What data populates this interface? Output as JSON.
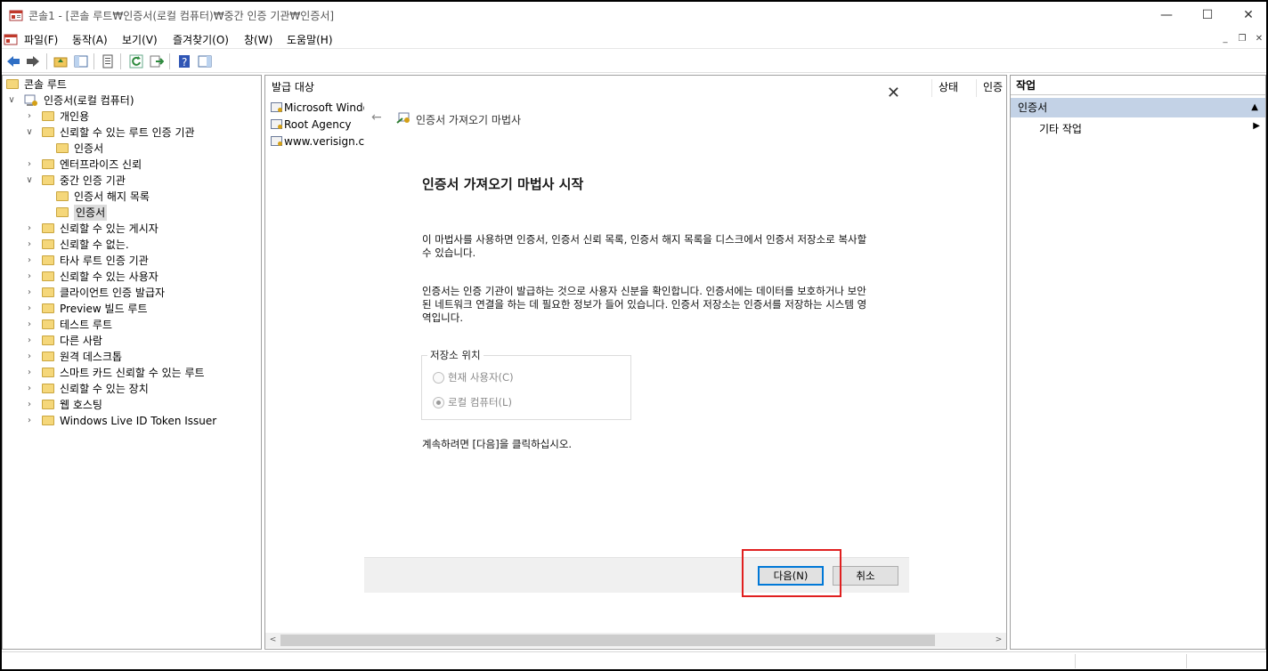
{
  "window": {
    "title": "콘솔1 - [콘솔 루트₩인증서(로컬 컴퓨터)₩중간 인증 기관₩인증서]",
    "minimize": "—",
    "maximize": "☐",
    "close": "✕"
  },
  "menu": [
    "파일(F)",
    "동작(A)",
    "보기(V)",
    "즐겨찾기(O)",
    "창(W)",
    "도움말(H)"
  ],
  "toolbar_icons": [
    "back-icon",
    "forward-icon",
    "up-folder-icon",
    "show-hide-tree-icon",
    "properties-icon",
    "refresh-icon",
    "export-list-icon",
    "help-icon",
    "show-hide-action-pane-icon"
  ],
  "tree": {
    "root": "콘솔 루트",
    "computer": "인증서(로컬 컴퓨터)",
    "items": [
      {
        "label": "개인용",
        "level": 2
      },
      {
        "label": "신뢰할 수 있는 루트 인증 기관",
        "level": 2,
        "expanded": true
      },
      {
        "label": "인증서",
        "level": 3
      },
      {
        "label": "엔터프라이즈 신뢰",
        "level": 2
      },
      {
        "label": "중간 인증 기관",
        "level": 2,
        "expanded": true
      },
      {
        "label": "인증서 해지 목록",
        "level": 3
      },
      {
        "label": "인증서",
        "level": 3,
        "selected": true
      },
      {
        "label": "신뢰할 수 있는 게시자",
        "level": 2
      },
      {
        "label": "신뢰할 수 없는.",
        "level": 2
      },
      {
        "label": "타사 루트 인증 기관",
        "level": 2
      },
      {
        "label": "신뢰할 수 있는 사용자",
        "level": 2
      },
      {
        "label": "클라이언트 인증 발급자",
        "level": 2
      },
      {
        "label": "Preview 빌드 루트",
        "level": 2
      },
      {
        "label": "테스트 루트",
        "level": 2
      },
      {
        "label": "다른 사람",
        "level": 2
      },
      {
        "label": "원격 데스크톱",
        "level": 2
      },
      {
        "label": "스마트 카드 신뢰할 수 있는 루트",
        "level": 2
      },
      {
        "label": "신뢰할 수 있는 장치",
        "level": 2
      },
      {
        "label": "웹 호스팅",
        "level": 2
      },
      {
        "label": "Windows Live ID Token Issuer",
        "level": 2
      }
    ]
  },
  "list": {
    "columns": {
      "issued_to": "발급 대상",
      "status": "상태",
      "purpose": "인증"
    },
    "rows": [
      "Microsoft Windo",
      "Root Agency",
      "www.verisign.co"
    ]
  },
  "wizard": {
    "title": "인증서 가져오기 마법사",
    "heading": "인증서 가져오기 마법사 시작",
    "para1": "이 마법사를 사용하면 인증서, 인증서 신뢰 목록, 인증서 해지 목록을 디스크에서 인증서 저장소로 복사할 수 있습니다.",
    "para2": "인증서는 인증 기관이 발급하는 것으로 사용자 신분을 확인합니다. 인증서에는 데이터를 보호하거나 보안된 네트워크 연결을 하는 데 필요한 정보가 들어 있습니다. 인증서 저장소는 인증서를 저장하는 시스템 영역입니다.",
    "store_legend": "저장소 위치",
    "option_current_user": "현재 사용자(C)",
    "option_local_machine": "로컬 컴퓨터(L)",
    "selected_option": "local_machine",
    "continue_text": "계속하려면 [다음]을 클릭하십시오.",
    "next_button": "다음(N)",
    "cancel_button": "취소"
  },
  "actions": {
    "header": "작업",
    "section": "인증서",
    "more_actions": "기타 작업"
  },
  "colors": {
    "highlight": "#e02020",
    "actions_section": "#c3d2e6",
    "primary_button_border": "#0078d7"
  }
}
